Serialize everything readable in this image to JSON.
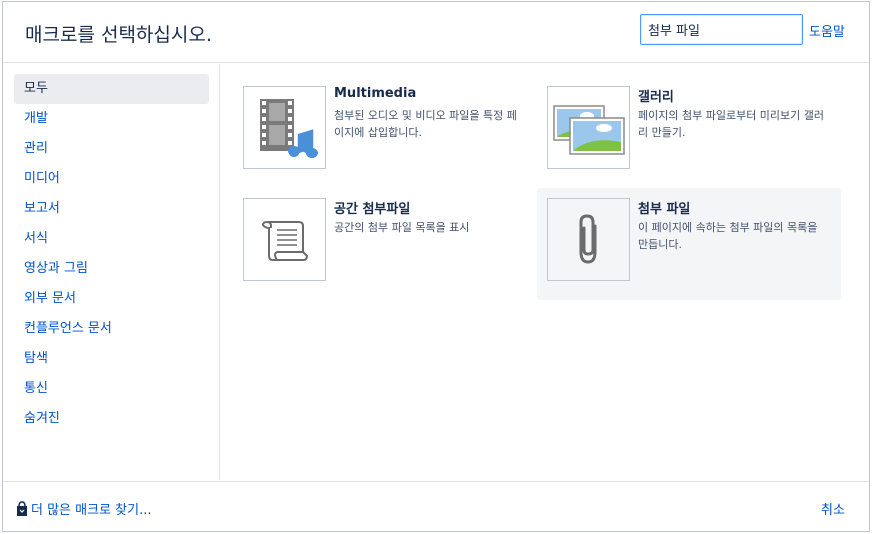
{
  "header": {
    "title": "매크로를 선택하십시오.",
    "search_value": "첨부 파일",
    "help_label": "도움말"
  },
  "sidebar": {
    "items": [
      {
        "label": "모두",
        "selected": true
      },
      {
        "label": "개발"
      },
      {
        "label": "관리"
      },
      {
        "label": "미디어"
      },
      {
        "label": "보고서"
      },
      {
        "label": "서식"
      },
      {
        "label": "영상과 그림"
      },
      {
        "label": "외부 문서"
      },
      {
        "label": "컨플루언스 문서"
      },
      {
        "label": "탐색"
      },
      {
        "label": "통신"
      },
      {
        "label": "숨겨진"
      }
    ]
  },
  "macros": [
    {
      "title": "Multimedia",
      "description": "첨부된 오디오 및 비디오 파일을 특정 페이지에 삽입합니다.",
      "icon": "multimedia-icon"
    },
    {
      "title": "갤러리",
      "description": "페이지의 첨부 파일로부터 미리보기 갤러리 만들기.",
      "icon": "gallery-icon"
    },
    {
      "title": "공간 첨부파일",
      "description": "공간의 첨부 파일 목록을 표시",
      "icon": "scroll-icon"
    },
    {
      "title": "첨부 파일",
      "description": "이 페이지에 속하는 첨부 파일의 목록을 만듭니다.",
      "icon": "paperclip-icon",
      "highlighted": true
    }
  ],
  "footer": {
    "more_label": "더 많은 매크로 찾기...",
    "cancel_label": "취소"
  },
  "colors": {
    "link": "#0052cc",
    "text": "#172b4d",
    "selected_bg": "#ebecf0",
    "highlight_bg": "#f4f5f7",
    "focus_border": "#4c9aff"
  }
}
